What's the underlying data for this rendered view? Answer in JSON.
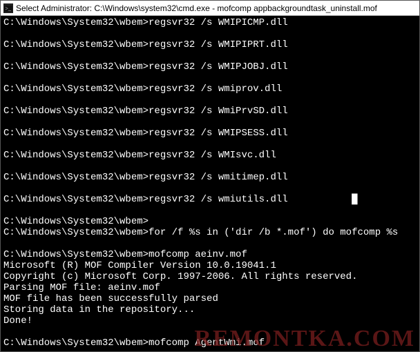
{
  "title": "Select Administrator: C:\\Windows\\system32\\cmd.exe - mofcomp  appbackgroundtask_uninstall.mof",
  "prompt": "C:\\Windows\\System32\\wbem>",
  "reg_cmd_prefix": "regsvr32 /s ",
  "dlls": [
    "WMIPICMP.dll",
    "WMIPIPRT.dll",
    "WMIPJOBJ.dll",
    "wmiprov.dll",
    "WmiPrvSD.dll",
    "WMIPSESS.dll",
    "WMIsvc.dll",
    "wmitimep.dll",
    "wmiutils.dll"
  ],
  "for_cmd": "for /f %s in ('dir /b *.mof') do mofcomp %s",
  "mofcomp1_cmd": "mofcomp aeinv.mof",
  "mof_out": [
    "Microsoft (R) MOF Compiler Version 10.0.19041.1",
    "Copyright (c) Microsoft Corp. 1997-2006. All rights reserved.",
    "Parsing MOF file: aeinv.mof",
    "MOF file has been successfully parsed",
    "Storing data in the repository...",
    "Done!"
  ],
  "mofcomp2_cmd": "mofcomp AgentWmi.mof",
  "watermark": "REMONTKA.COM"
}
